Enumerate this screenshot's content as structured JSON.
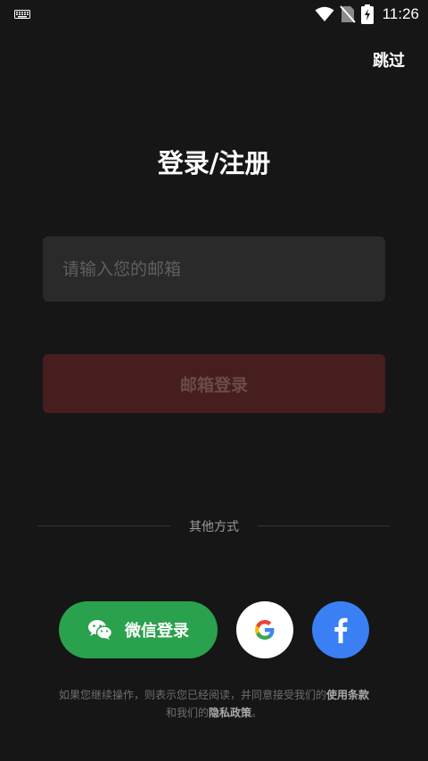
{
  "status_bar": {
    "time": "11:26",
    "icons": [
      "keyboard-icon",
      "wifi-icon",
      "no-sim-icon",
      "battery-charging-icon"
    ]
  },
  "header": {
    "skip_label": "跳过",
    "title": "登录/注册"
  },
  "form": {
    "email_placeholder": "请输入您的邮箱",
    "email_value": "",
    "email_login_label": "邮箱登录"
  },
  "other": {
    "divider_label": "其他方式",
    "wechat_label": "微信登录",
    "wechat_icon": "wechat-icon",
    "google_icon": "google-icon",
    "facebook_icon": "facebook-icon"
  },
  "terms": {
    "prefix": "如果您继续操作，则表示您已经阅读，并同意接受我们的",
    "terms_link": "使用条款",
    "middle": "和我们的",
    "privacy_link": "隐私政策",
    "suffix": "。"
  },
  "colors": {
    "background": "#161616",
    "wechat_green": "#2aa14c",
    "facebook_blue": "#3b7ff5",
    "disabled_login": "#461e1e"
  }
}
